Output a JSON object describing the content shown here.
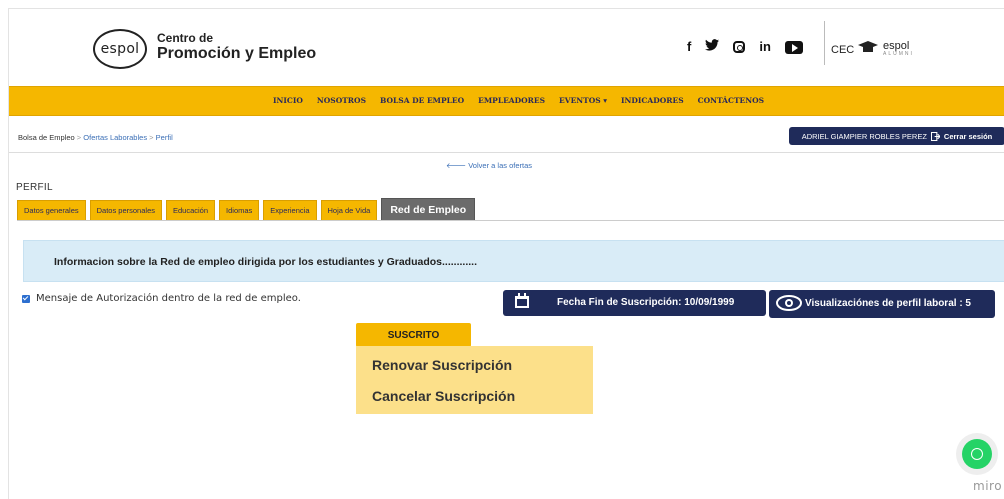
{
  "header": {
    "logo_text": "espol",
    "brand_line1": "Centro de",
    "brand_line2": "Promoción y Empleo",
    "social": [
      "f",
      "twitter-icon",
      "instagram-icon",
      "in",
      "youtube-icon"
    ],
    "cec_label": "CEC",
    "alumni_logo": "espol",
    "alumni_sub": "ALUMNI"
  },
  "nav": {
    "items": [
      "INICIO",
      "NOSOTROS",
      "BOLSA DE EMPLEO",
      "EMPLEADORES",
      "EVENTOS ▾",
      "INDICADORES",
      "CONTÁCTENOS"
    ],
    "color": "#f5b700"
  },
  "breadcrumb": {
    "root": "Bolsa de Empleo",
    "sep": ">",
    "level2": "Ofertas Laborables",
    "level3": "Perfil"
  },
  "user": {
    "name": "ADRIEL GIAMPIER ROBLES PEREZ",
    "logout": "Cerrar sesión"
  },
  "back_link": "Volver a las ofertas",
  "page_title": "PERFIL",
  "tabs": [
    "Datos generales",
    "Datos personales",
    "Educación",
    "Idiomas",
    "Experiencia",
    "Hoja de Vida",
    "Red de Empleo"
  ],
  "active_tab": "Red de Empleo",
  "info_text": "Informacion sobre la Red de empleo dirigida por los estudiantes y Graduados............",
  "authorization_label": "Mensaje de Autorización dentro de la red de empleo.",
  "subscription_end": "Fecha Fin de Suscripción: 10/09/1999",
  "profile_views": "Visualizaciónes de perfil laboral : 5",
  "status_button": "SUSCRITO",
  "dropdown": {
    "renew": "Renovar Suscripción",
    "cancel": "Cancelar Suscripción"
  },
  "watermark": "miro",
  "colors": {
    "accent": "#f5b700",
    "navy": "#1f2b5a",
    "info_bg": "#d9ecf7",
    "dropdown_bg": "#fce08a",
    "whatsapp": "#25d366"
  }
}
